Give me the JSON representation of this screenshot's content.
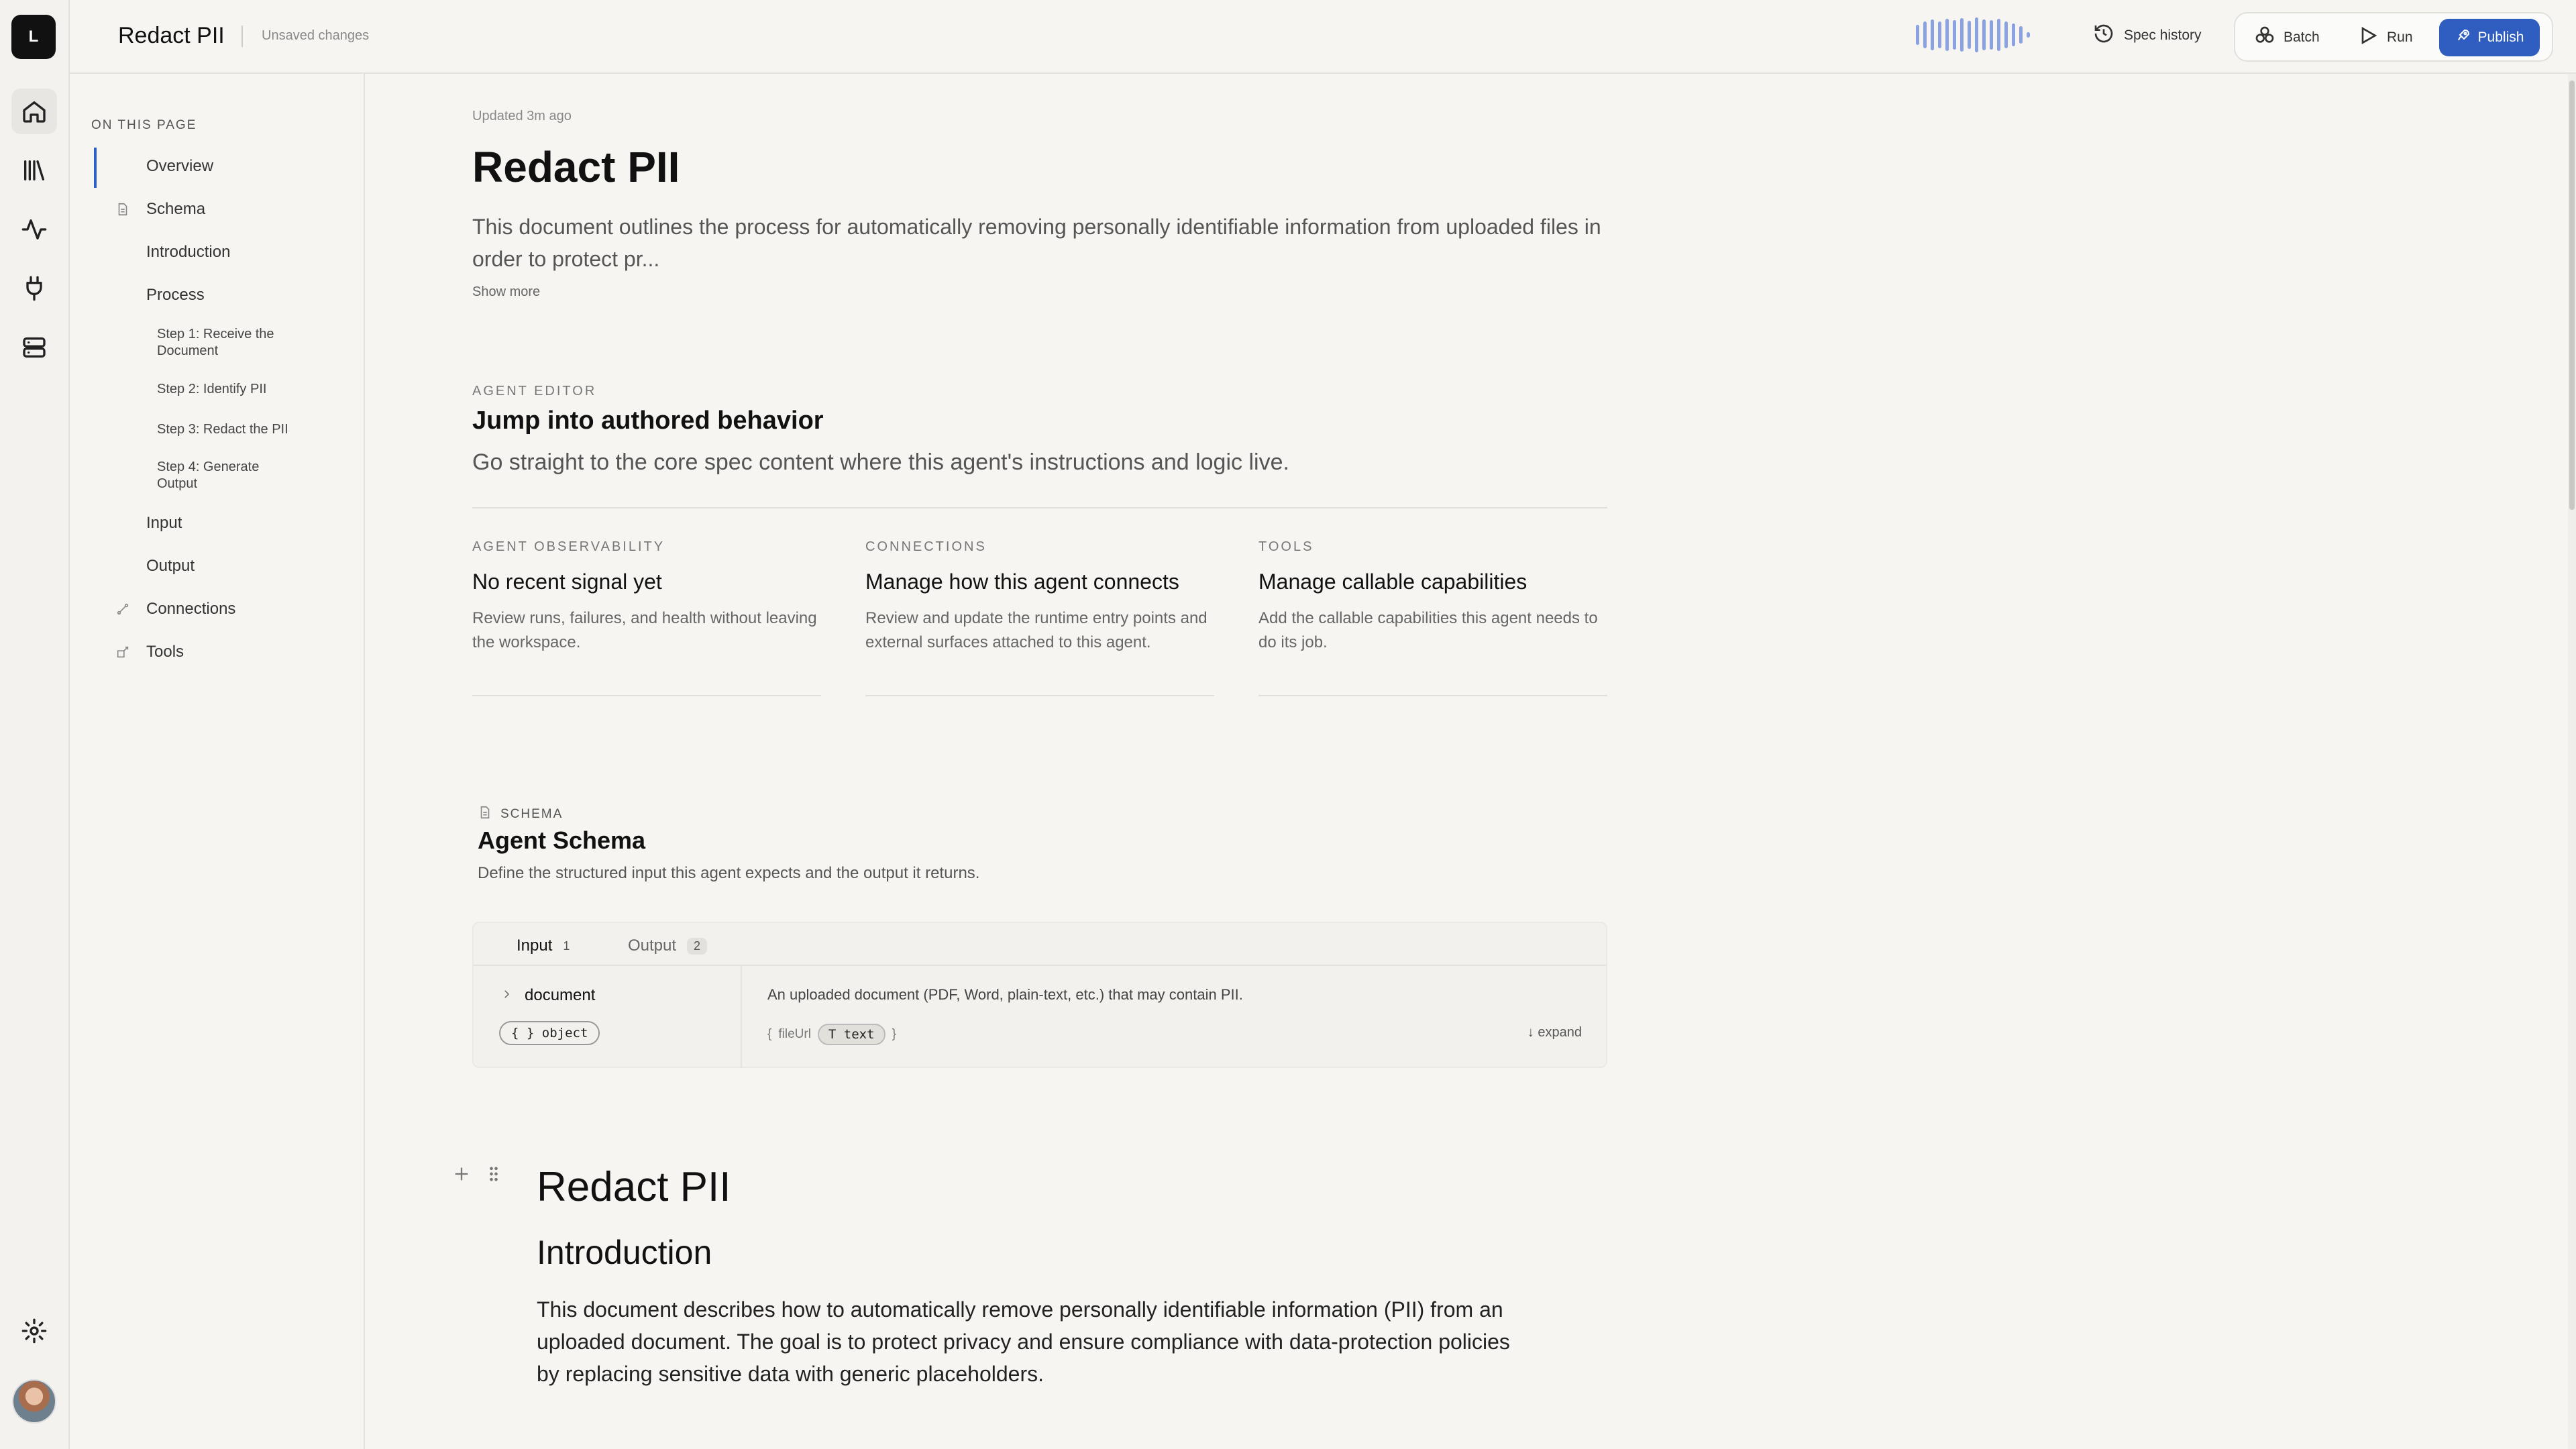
{
  "app": {
    "logo_letter": "L",
    "title": "Redact PII",
    "status": "Unsaved changes"
  },
  "rail": {
    "icons": [
      "home-icon",
      "library-icon",
      "activity-icon",
      "plug-icon",
      "server-icon",
      "gear-icon"
    ]
  },
  "toc": {
    "heading": "ON THIS PAGE",
    "items": [
      {
        "label": "Overview",
        "level": 1,
        "active": true
      },
      {
        "label": "Schema",
        "level": 1,
        "icon": "document-icon"
      },
      {
        "label": "Introduction",
        "level": 1
      },
      {
        "label": "Process",
        "level": 1
      },
      {
        "label": "Step 1: Receive the Document",
        "level": 2
      },
      {
        "label": "Step 2: Identify PII",
        "level": 2
      },
      {
        "label": "Step 3: Redact the PII",
        "level": 2
      },
      {
        "label": "Step 4: Generate Output",
        "level": 2
      },
      {
        "label": "Input",
        "level": 1
      },
      {
        "label": "Output",
        "level": 1
      },
      {
        "label": "Connections",
        "level": 1,
        "icon": "connection-icon"
      },
      {
        "label": "Tools",
        "level": 1,
        "icon": "tools-icon"
      }
    ]
  },
  "toolbar": {
    "spec_history": "Spec history",
    "batch": "Batch",
    "run": "Run",
    "publish": "Publish"
  },
  "overview": {
    "updated": "Updated 3m ago",
    "title": "Redact PII",
    "description": "This document outlines the process for automatically removing personally identifiable information from uploaded files in order to protect pr...",
    "show_more": "Show more"
  },
  "agent_editor": {
    "eyebrow": "AGENT EDITOR",
    "title": "Jump into authored behavior",
    "description": "Go straight to the core spec content where this agent's instructions and logic live."
  },
  "cards": [
    {
      "eyebrow": "AGENT OBSERVABILITY",
      "title": "No recent signal yet",
      "description": "Review runs, failures, and health without leaving the workspace."
    },
    {
      "eyebrow": "CONNECTIONS",
      "title": "Manage how this agent connects",
      "description": "Review and update the runtime entry points and external surfaces attached to this agent."
    },
    {
      "eyebrow": "TOOLS",
      "title": "Manage callable capabilities",
      "description": "Add the callable capabilities this agent needs to do its job."
    }
  ],
  "schema": {
    "eyebrow": "SCHEMA",
    "title": "Agent Schema",
    "description": "Define the structured input this agent expects and the output it returns.",
    "tabs": [
      {
        "label": "Input",
        "count": "1"
      },
      {
        "label": "Output",
        "count": "2"
      }
    ],
    "field": {
      "name": "document",
      "type": "{ } object",
      "description": "An uploaded document (PDF, Word, plain-text, etc.) that may contain PII.",
      "open_brace": "{",
      "subfield": "fileUrl",
      "subfield_type": "T text",
      "close_brace": "}",
      "expand": "↓ expand"
    }
  },
  "document": {
    "h1": "Redact PII",
    "h2": "Introduction",
    "paragraph": "This document describes how to automatically remove personally identifiable information (PII) from an uploaded document. The goal is to protect privacy and ensure compliance with data-protection policies by replacing sensitive data with generic placeholders."
  },
  "colors": {
    "accent": "#2f5ec0",
    "waveform": "#8aa3e0",
    "background": "#f6f5f2"
  }
}
